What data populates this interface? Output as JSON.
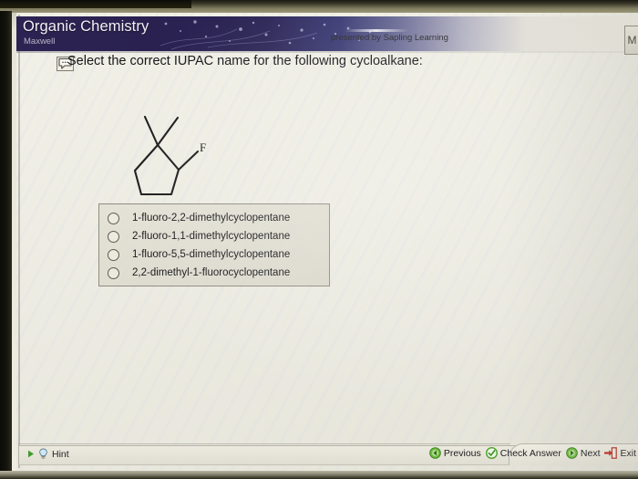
{
  "header": {
    "course_title": "Organic Chemistry",
    "instructor": "Maxwell",
    "presented_by": "presented by Sapling Learning",
    "edge_tab_label": "M"
  },
  "question": {
    "prompt": "Select the correct IUPAC name for the following cycloalkane:",
    "prompt_icon": "speech-bubble-icon",
    "molecule": {
      "name": "1-fluoro-2,2-dimethylcyclopentane structure",
      "ring": "cyclopentane",
      "substituent_labels": [
        "F"
      ],
      "methyl_count": 2
    },
    "options": [
      {
        "id": "a",
        "label": "1-fluoro-2,2-dimethylcyclopentane",
        "selected": false
      },
      {
        "id": "b",
        "label": "2-fluoro-1,1-dimethylcyclopentane",
        "selected": false
      },
      {
        "id": "c",
        "label": "1-fluoro-5,5-dimethylcyclopentane",
        "selected": false
      },
      {
        "id": "d",
        "label": "2,2-dimethyl-1-fluorocyclopentane",
        "selected": false
      }
    ]
  },
  "toolbar": {
    "hint_label": "Hint",
    "hint_icon": "lightbulb-icon",
    "hint_expand_icon": "play-triangle-icon",
    "previous_label": "Previous",
    "previous_icon": "arrow-left-circle-icon",
    "check_answer_label": "Check Answer",
    "check_answer_icon": "check-circle-icon",
    "next_label": "Next",
    "next_icon": "arrow-right-circle-icon",
    "exit_label": "Exit",
    "exit_icon": "exit-door-icon"
  },
  "colors": {
    "banner_start": "#2c2352",
    "banner_end": "#eeece2",
    "page_background": "#eeece2",
    "option_box_border": "#8f8d81",
    "green_accent": "#4f9f2f",
    "red_accent": "#c02a20"
  }
}
